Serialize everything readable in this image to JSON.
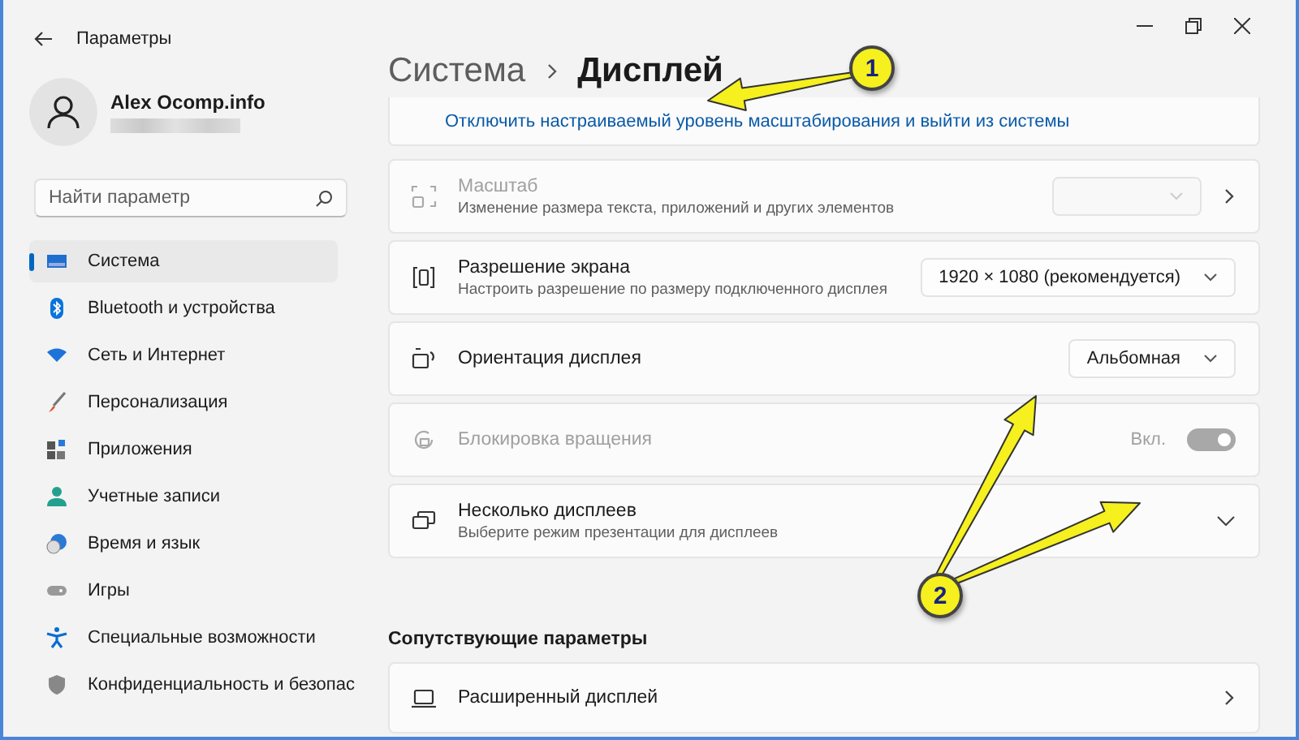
{
  "window": {
    "title": "Параметры"
  },
  "user": {
    "name": "Alex Ocomp.info"
  },
  "search": {
    "placeholder": "Найти параметр"
  },
  "sidebar": {
    "items": [
      {
        "label": "Система",
        "selected": true
      },
      {
        "label": "Bluetooth и устройства",
        "selected": false
      },
      {
        "label": "Сеть и Интернет",
        "selected": false
      },
      {
        "label": "Персонализация",
        "selected": false
      },
      {
        "label": "Приложения",
        "selected": false
      },
      {
        "label": "Учетные записи",
        "selected": false
      },
      {
        "label": "Время и язык",
        "selected": false
      },
      {
        "label": "Игры",
        "selected": false
      },
      {
        "label": "Специальные возможности",
        "selected": false
      },
      {
        "label": "Конфиденциальность и безопас",
        "selected": false
      }
    ]
  },
  "breadcrumb": {
    "parent": "Система",
    "current": "Дисплей"
  },
  "scale_link": "Отключить настраиваемый уровень масштабирования и выйти из системы",
  "settings": [
    {
      "kind": "select",
      "title": "Масштаб",
      "subtitle": "Изменение размера текста, приложений и других элементов",
      "disabled": true,
      "navigates": true
    },
    {
      "kind": "select",
      "title": "Разрешение экрана",
      "subtitle": "Настроить разрешение по размеру подключенного дисплея",
      "value": "1920 × 1080 (рекомендуется)",
      "disabled": false,
      "navigates": false
    },
    {
      "kind": "select",
      "title": "Ориентация дисплея",
      "value": "Альбомная",
      "disabled": false,
      "navigates": false
    },
    {
      "kind": "toggle",
      "title": "Блокировка вращения",
      "state_label": "Вкл.",
      "on": true,
      "disabled": true
    },
    {
      "kind": "expand",
      "title": "Несколько дисплеев",
      "subtitle": "Выберите режим презентации для дисплеев",
      "expanded": false
    }
  ],
  "related": {
    "heading": "Сопутствующие параметры",
    "items": [
      {
        "title": "Расширенный дисплей"
      }
    ]
  },
  "annotations": [
    {
      "label": "1"
    },
    {
      "label": "2"
    }
  ]
}
